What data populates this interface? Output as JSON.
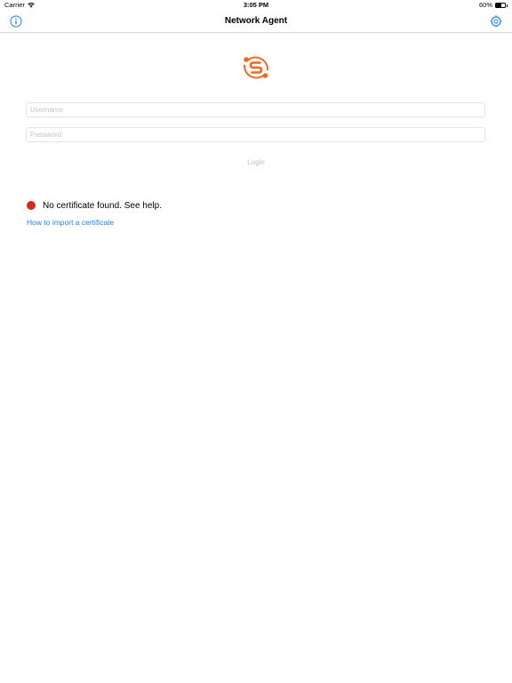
{
  "status_bar": {
    "carrier": "Carrier",
    "time": "3:05 PM",
    "battery_percent": "60%",
    "battery_level": 0.6,
    "wifi_icon": "wifi-icon"
  },
  "nav": {
    "title": "Network Agent",
    "left_icon": "info-icon",
    "right_icon": "gear-icon"
  },
  "colors": {
    "accent_blue": "#2b7fdd",
    "logo_orange": "#f06a1e",
    "error_red": "#d42a20"
  },
  "login": {
    "username_placeholder": "Username",
    "password_placeholder": "Password",
    "username_value": "",
    "password_value": "",
    "button_label": "Login"
  },
  "certificate": {
    "status_text": "No certificate found. See help.",
    "help_link": "How to import a certificate"
  }
}
